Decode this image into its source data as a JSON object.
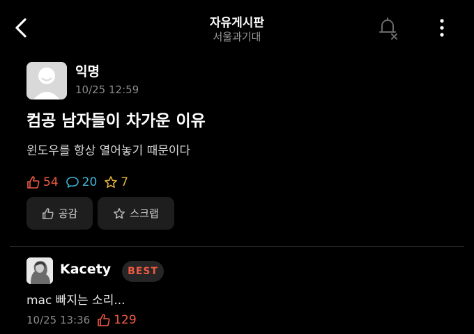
{
  "header": {
    "title": "자유게시판",
    "subtitle": "서울과기대"
  },
  "post": {
    "author": "익명",
    "time": "10/25 12:59",
    "title": "컴공 남자들이 차가운 이유",
    "body": "윈도우를 항상 열어놓기 때문이다",
    "likes": "54",
    "comments": "20",
    "scraps": "7"
  },
  "actions": {
    "like_label": "공감",
    "scrap_label": "스크랩"
  },
  "comment": {
    "author": "Kacety",
    "badge": "BEST",
    "text": "mac 빠지는 소리...",
    "time": "10/25 13:36",
    "likes": "129"
  },
  "colors": {
    "like": "#f15a43",
    "comment": "#3fb6d8",
    "scrap": "#e2b23b",
    "background": "#000000"
  },
  "icons": [
    "back-arrow-icon",
    "bell-off-icon",
    "more-vertical-icon",
    "thumbs-up-icon",
    "speech-bubble-icon",
    "star-icon"
  ]
}
